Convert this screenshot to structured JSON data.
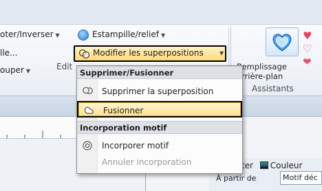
{
  "ribbon": {
    "flip_button_label": "oter/Inverser",
    "estampille_label": "Estampille/relief",
    "style_button_label": "lle...",
    "group_button_label": "ouper",
    "edit_group_label": "Edit",
    "modify_overlaps_label": "Modifier les superpositions",
    "fill_button_line1": "Remplissage",
    "fill_button_line2": "arrière-plan",
    "assistants_group_label": "Assistants"
  },
  "dropdown": {
    "header_delete_merge": "Supprimer/Fusionner",
    "item_delete_overlap": "Supprimer la superposition",
    "item_merge": "Fusionner",
    "header_incorporation": "Incorporation motif",
    "item_incorporate": "Incorporer motif",
    "item_cancel_incorporation": "Annuler incorporation"
  },
  "panel": {
    "tab_partial": "rter",
    "tab_color": "Couleur",
    "from_label": "À partir de",
    "motif_field_value": "Motif déc"
  },
  "colors": {
    "highlight": "#ffe08a",
    "hearts": "#e0516e",
    "accent_blue": "#2e7fd6"
  }
}
